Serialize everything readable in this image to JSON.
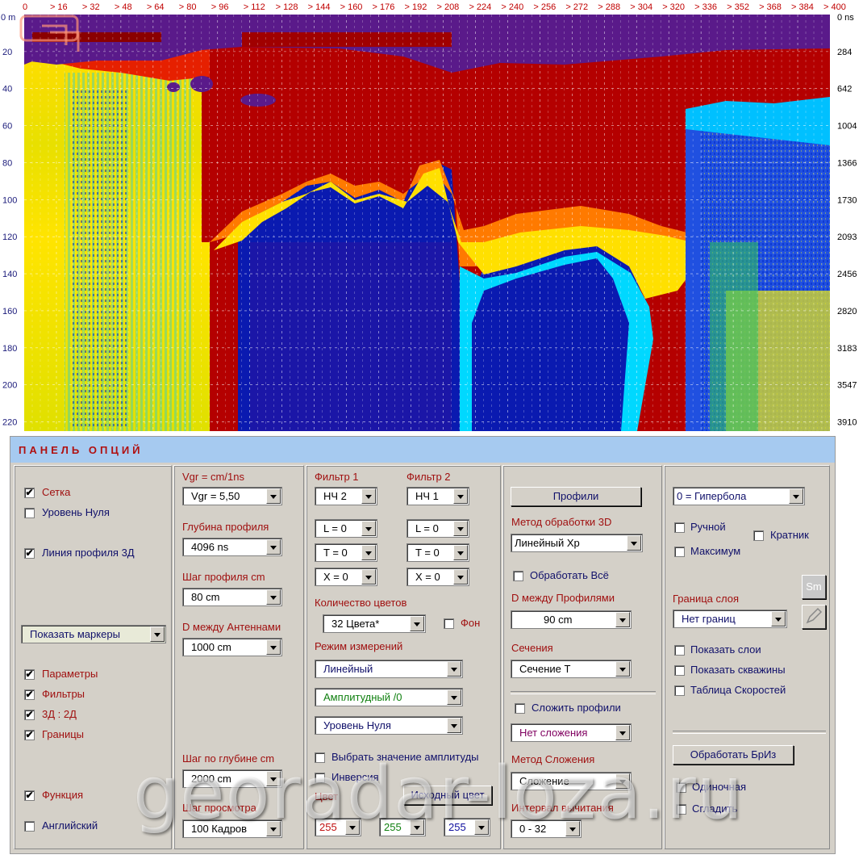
{
  "radar": {
    "top_axis_labels": [
      "0",
      "16",
      "32",
      "48",
      "64",
      "80",
      "96",
      "112",
      "128",
      "144",
      "160",
      "176",
      "192",
      "208",
      "224",
      "240",
      "256",
      "272",
      "288",
      "304",
      "320",
      "336",
      "352",
      "368",
      "384",
      "400"
    ],
    "top_axis_prefix": "0 m",
    "left_axis_labels": [
      "20",
      "40",
      "60",
      "80",
      "100",
      "120",
      "140",
      "160",
      "180",
      "200",
      "220"
    ],
    "right_axis_unit": "0 ns",
    "right_axis_labels": [
      "284",
      "642",
      "1004",
      "1366",
      "1730",
      "2093",
      "2456",
      "2820",
      "3183",
      "3547",
      "3910"
    ]
  },
  "panel": {
    "title": "ПАНЕЛЬ ОПЦИЙ",
    "col1": {
      "grid": {
        "label": "Сетка",
        "checked": true
      },
      "zero_level": {
        "label": "Уровень Нуля",
        "checked": false
      },
      "profile_line": {
        "label": "Линия профиля 3Д",
        "checked": true
      },
      "markers": {
        "value": "Показать маркеры"
      },
      "params": {
        "label": "Параметры",
        "checked": true
      },
      "filters": {
        "label": "Фильтры",
        "checked": true
      },
      "view3d": {
        "label": "3Д : 2Д",
        "checked": true
      },
      "bounds": {
        "label": "Границы",
        "checked": true
      },
      "function": {
        "label": "Функция",
        "checked": true
      },
      "english": {
        "label": "Английский",
        "checked": false
      }
    },
    "col2": {
      "vgr_label": "Vgr = cm/1ns",
      "vgr_value": "Vgr =   5,50",
      "depth_label": "Глубина профиля",
      "depth_value": "4096  ns",
      "step_label": "Шаг профиля cm",
      "step_value": "80 cm",
      "dist_label": "D между Антеннами",
      "dist_value": "1000 cm",
      "depth_step_label": "Шаг по глубине cm",
      "depth_step_value": "2000 cm",
      "view_step_label": "Шаг просмотра",
      "view_step_value": "100 Кадров"
    },
    "col3": {
      "filter1_label": "Фильтр 1",
      "filter2_label": "Фильтр 2",
      "f1": [
        "НЧ 2",
        "L = 0",
        "T = 0",
        "X = 0"
      ],
      "f2": [
        "НЧ 1",
        "L = 0",
        "T = 0",
        "X = 0"
      ],
      "colors_label": "Количество цветов",
      "colors_value": "32 Цвета*",
      "bg": {
        "label": "Фон",
        "checked": false
      },
      "mode_label": "Режим измерений",
      "mode1": "Линейный",
      "mode2": "Амплитудный /0",
      "mode3": "Уровень Нуля",
      "pick_amp": {
        "label": "Выбрать значение амплитуды",
        "checked": false
      },
      "inversion": {
        "label": "Инверсия",
        "checked": false
      },
      "color_label": "Цвет",
      "src_color_button": "Исходный цвет",
      "rgb": [
        "255",
        "255",
        "255"
      ]
    },
    "col4": {
      "profiles_button": "Профили",
      "method3d_label": "Метод обработки 3D",
      "method3d_value": "Линейный Хр",
      "process_all": {
        "label": "Обработать Всё",
        "checked": false
      },
      "dprof_label": "D между Профилями",
      "dprof_value": "90 cm",
      "sections_label": "Сечения",
      "sections_value": "Сечение Т",
      "sum_profiles": {
        "label": "Сложить профили",
        "checked": false
      },
      "sum_value": "Нет сложения",
      "sum_method_label": "Метод Сложения",
      "sum_method_value": "Сложение",
      "interval_label": "Интервал вычитания",
      "interval_value": "0 - 32"
    },
    "col5": {
      "hyperbola_value": "0 = Гипербола",
      "manual": {
        "label": "Ручной",
        "checked": false
      },
      "multiple": {
        "label": "Кратник",
        "checked": false
      },
      "maximum": {
        "label": "Максимум",
        "checked": false
      },
      "sm_button": "Sm",
      "layer_label": "Граница слоя",
      "layer_value": "Нет границ",
      "show_layers": {
        "label": "Показать слои",
        "checked": false
      },
      "show_wells": {
        "label": "Показать скважины",
        "checked": false
      },
      "vel_table": {
        "label": "Таблица Скоростей",
        "checked": false
      },
      "process_briz_button": "Обработать БрИз",
      "single": {
        "label": "Одиночная",
        "checked": false
      },
      "smooth": {
        "label": "Сгладить",
        "checked": false
      }
    }
  },
  "watermark": "georadar-loza.ru"
}
